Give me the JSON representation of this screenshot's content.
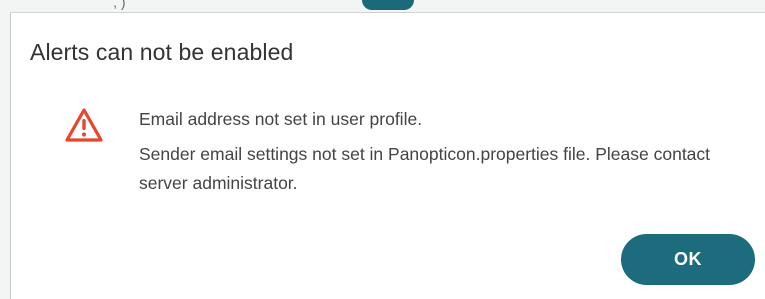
{
  "background": {
    "glyph": "ʼ, )"
  },
  "dialog": {
    "title": "Alerts can not be enabled",
    "icon": "warning-triangle-icon",
    "messages": [
      "Email address not set in user profile.",
      "Sender email settings not set in Panopticon.properties file. Please contact server administrator."
    ],
    "ok_label": "OK"
  },
  "colors": {
    "warning": "#e8452c",
    "button": "#1c6c7e",
    "title_text": "#333333",
    "body_text": "#444444"
  }
}
